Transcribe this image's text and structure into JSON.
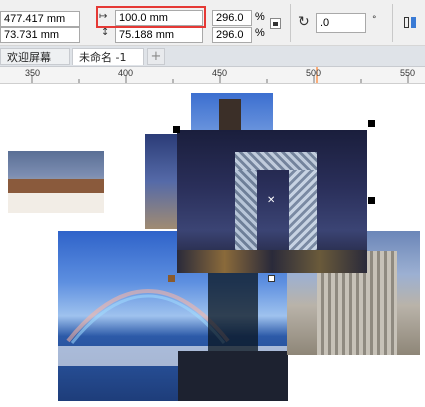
{
  "propbar": {
    "x_value": "477.417 mm",
    "y_value": "73.731 mm",
    "width_value": "100.0 mm",
    "height_value": "75.188 mm",
    "scale_w": "296.0",
    "scale_h": "296.0",
    "percent_symbol": "%",
    "rotation_value": ".0"
  },
  "tabs": {
    "welcome": "欢迎屏幕",
    "untitled": "未命名 -1",
    "add": "+"
  },
  "ruler": {
    "ticks": [
      "350",
      "400",
      "450",
      "500",
      "550"
    ]
  },
  "icons": {
    "width": "width-arrows-icon",
    "height": "height-arrows-icon",
    "lock": "lock-icon",
    "rotate": "rotate-icon",
    "mirror": "mirror-icon"
  }
}
